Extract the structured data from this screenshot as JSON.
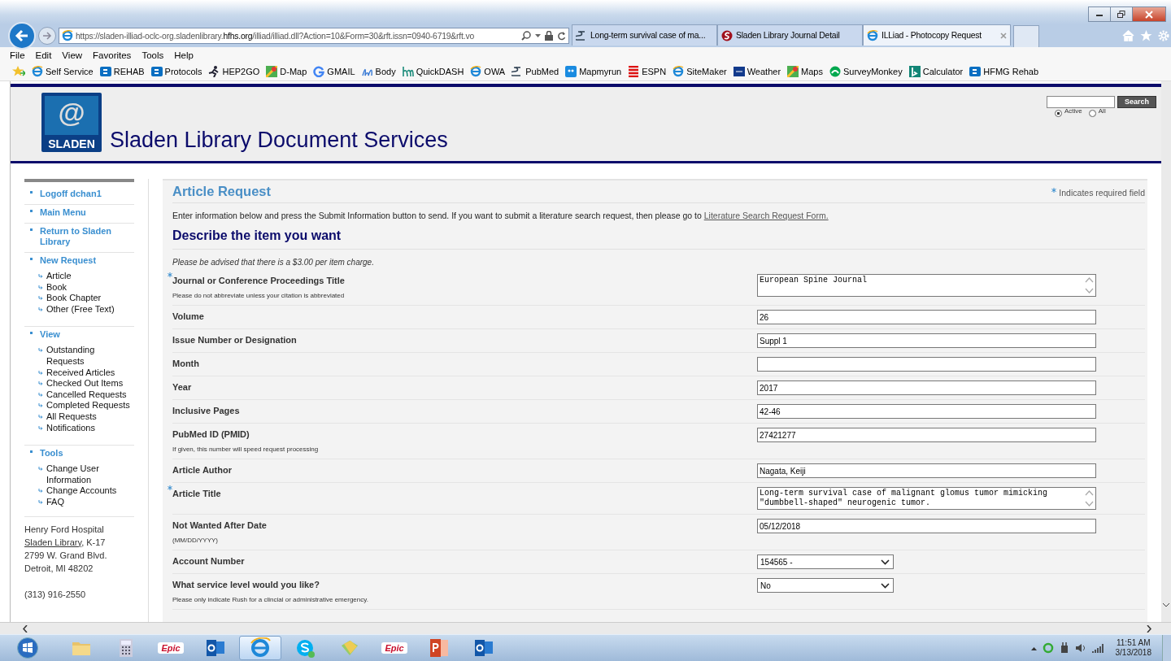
{
  "browser": {
    "address": {
      "scheme": "https://",
      "host_pre": "sladen-illiad-oclc-org.sladenlibrary.",
      "host": "hfhs.org",
      "path": "/illiad/illiad.dll?Action=10&Form=30&rft.issn=0940-6719&rft.vo"
    },
    "tabs": [
      {
        "title": "Long-term survival case of ma...",
        "selected": false,
        "kind": "pubmed"
      },
      {
        "title": "Sladen Library Journal Detail",
        "selected": false,
        "kind": "sladen"
      },
      {
        "title": "ILLiad - Photocopy Request",
        "selected": true,
        "kind": "ie"
      }
    ],
    "menu": [
      "File",
      "Edit",
      "View",
      "Favorites",
      "Tools",
      "Help"
    ],
    "favorites": [
      {
        "label": "Self Service",
        "kind": "ie"
      },
      {
        "label": "REHAB",
        "kind": "sp"
      },
      {
        "label": "Protocols",
        "kind": "sp"
      },
      {
        "label": "HEP2GO",
        "kind": "runner"
      },
      {
        "label": "D-Map",
        "kind": "maps"
      },
      {
        "label": "GMAIL",
        "kind": "g"
      },
      {
        "label": "Body",
        "kind": "bl"
      },
      {
        "label": "QuickDASH",
        "kind": "hm"
      },
      {
        "label": "OWA",
        "kind": "ie"
      },
      {
        "label": "PubMed",
        "kind": "pubmed"
      },
      {
        "label": "Mapmyrun",
        "kind": "mmr"
      },
      {
        "label": "ESPN",
        "kind": "espn"
      },
      {
        "label": "SiteMaker",
        "kind": "ie"
      },
      {
        "label": "Weather",
        "kind": "twc"
      },
      {
        "label": "Maps",
        "kind": "maps"
      },
      {
        "label": "SurveyMonkey",
        "kind": "sm"
      },
      {
        "label": "Calculator",
        "kind": "bing"
      },
      {
        "label": "HFMG Rehab",
        "kind": "sp"
      }
    ]
  },
  "header": {
    "logo": {
      "symbol": "@",
      "text": "SLADEN"
    },
    "title": "Sladen Library Document Services",
    "search": {
      "button": "Search",
      "scopes": [
        {
          "label": "Active",
          "selected": true
        },
        {
          "label": "All",
          "selected": false
        }
      ]
    }
  },
  "sidebar": {
    "sections": [
      {
        "label": "Logoff dchan1"
      },
      {
        "label": "Main Menu"
      },
      {
        "label": "Return to Sladen Library"
      },
      {
        "label": "New Request",
        "items": [
          "Article",
          "Book",
          "Book Chapter",
          "Other (Free Text)"
        ]
      },
      {
        "label": "View",
        "items": [
          "Outstanding Requests",
          "Received Articles",
          "Checked Out Items",
          "Cancelled Requests",
          "Completed Requests",
          "All Requests",
          "Notifications"
        ]
      },
      {
        "label": "Tools",
        "items": [
          "Change User Information",
          "Change Accounts",
          "FAQ"
        ]
      }
    ],
    "footer": [
      {
        "text": "Henry Ford Hospital"
      },
      {
        "link": "Sladen Library",
        "text": ", K-17"
      },
      {
        "text": "2799 W. Grand Blvd."
      },
      {
        "text": "Detroit, MI 48202"
      },
      {
        "text": "(313) 916-2550"
      }
    ]
  },
  "content": {
    "title": "Article Request",
    "required_note": "Indicates required field",
    "intro": {
      "text": "Enter information below and press the Submit Information button to send. If you want to submit a literature search request, then please go to ",
      "link": "Literature Search Request Form."
    },
    "section": "Describe the item you want",
    "notice": "Please be advised that there is a $3.00 per item charge.",
    "fields": [
      {
        "label": "Journal or Conference Proceedings Title",
        "required": true,
        "hint": "Please do not abbreviate unless your citation is abbreviated",
        "kind": "textarea",
        "value": "European Spine Journal"
      },
      {
        "label": "Volume",
        "required": false,
        "kind": "text",
        "value": "26"
      },
      {
        "label": "Issue Number or Designation",
        "required": false,
        "kind": "text",
        "value": "Suppl 1"
      },
      {
        "label": "Month",
        "required": false,
        "kind": "text"
      },
      {
        "label": "Year",
        "required": false,
        "kind": "text",
        "value": "2017"
      },
      {
        "label": "Inclusive Pages",
        "required": false,
        "kind": "text",
        "value": "42-46"
      },
      {
        "label": "PubMed ID (PMID)",
        "required": false,
        "hint": "If given, this number will speed request processing",
        "kind": "text",
        "value": "27421277"
      },
      {
        "label": "Article Author",
        "required": false,
        "kind": "text",
        "value": "Nagata, Keiji"
      },
      {
        "label": "Article Title",
        "required": true,
        "kind": "textarea",
        "value": "Long-term survival case of malignant glomus tumor mimicking \"dumbbell-shaped\" neurogenic tumor."
      },
      {
        "label": "Not Wanted After Date",
        "required": false,
        "hint": "(MM/DD/YYYY)",
        "kind": "text",
        "value": "05/12/2018"
      },
      {
        "label": "Account Number",
        "required": false,
        "kind": "select",
        "value": "154565 -"
      },
      {
        "label": "What service level would you like?",
        "required": false,
        "hint": "Please only indicate Rush for a clincial or administrative emergency.",
        "kind": "select",
        "value": "No"
      }
    ]
  },
  "taskbar": {
    "apps": [
      {
        "kind": "folder",
        "selected": false
      },
      {
        "kind": "calculator",
        "selected": false
      },
      {
        "kind": "epic",
        "label": "Epic",
        "selected": false
      },
      {
        "kind": "outlook",
        "selected": false
      },
      {
        "kind": "ie",
        "selected": true
      },
      {
        "kind": "skype",
        "selected": false
      },
      {
        "kind": "app",
        "selected": false
      },
      {
        "kind": "epic",
        "label": "Epic",
        "selected": false
      },
      {
        "kind": "powerpoint",
        "selected": false
      },
      {
        "kind": "outlook",
        "selected": false
      }
    ],
    "time": "11:51 AM",
    "date": "3/13/2018"
  }
}
